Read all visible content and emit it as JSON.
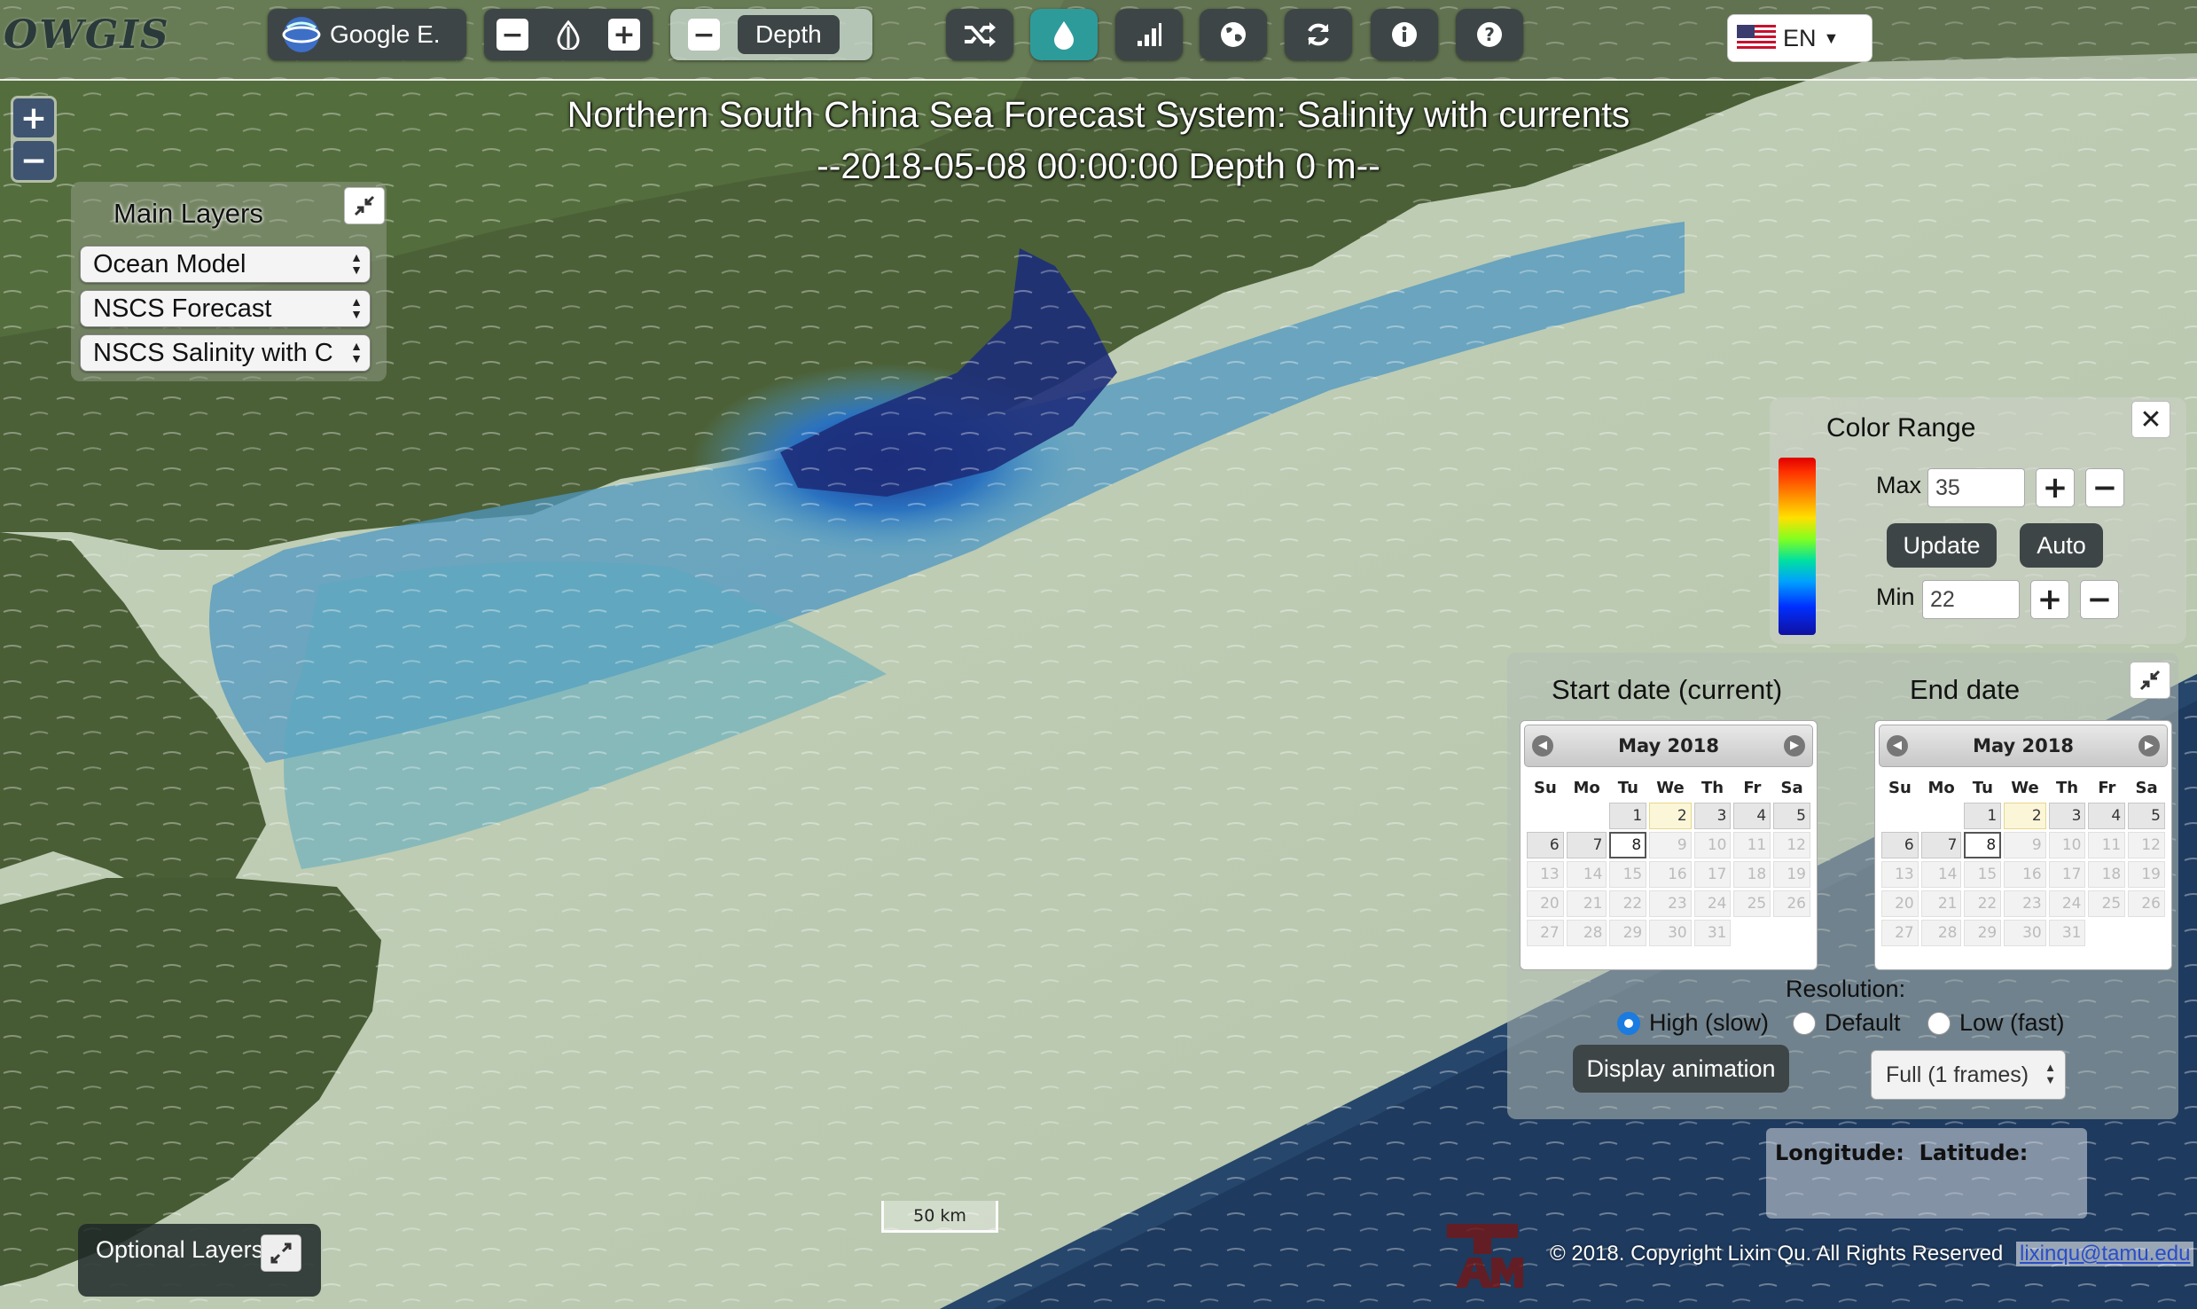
{
  "app": {
    "logo": "OWGIS"
  },
  "toolbar": {
    "base_layer_label": "Google E.",
    "depth_label": "Depth",
    "language": "EN"
  },
  "map": {
    "title_line1": "Northern South China Sea Forecast System: Salinity with currents",
    "title_line2": "--2018-05-08 00:00:00 Depth 0 m--",
    "scale_label": "50 km"
  },
  "main_layers": {
    "title": "Main Layers",
    "selects": [
      "Ocean Model",
      "NSCS Forecast",
      "NSCS Salinity with C"
    ]
  },
  "color_range": {
    "title": "Color Range",
    "max_label": "Max",
    "max_value": "35",
    "min_label": "Min",
    "min_value": "22",
    "update_label": "Update",
    "auto_label": "Auto"
  },
  "dates": {
    "start_title": "Start date (current)",
    "end_title": "End date",
    "calendar_month": "May 2018",
    "weekdays": [
      "Su",
      "Mo",
      "Tu",
      "We",
      "Th",
      "Fr",
      "Sa"
    ],
    "resolution_label": "Resolution:",
    "resolution_options": [
      "High (slow)",
      "Default",
      "Low (fast)"
    ],
    "resolution_selected": "High (slow)",
    "display_animation_label": "Display animation",
    "frames_select": "Full (1 frames)"
  },
  "coords": {
    "label": "Longitude:  Latitude:"
  },
  "optional_layers": {
    "title": "Optional Layers"
  },
  "footer": {
    "copyright": "© 2018. Copyright Lixin Qu. All Rights Reserved",
    "email": "lixinqu@tamu.edu"
  },
  "colors": {
    "accent_teal": "#2e9b9b",
    "toolbar_dark": "#3e4547",
    "radio_blue": "#1a7be0"
  }
}
